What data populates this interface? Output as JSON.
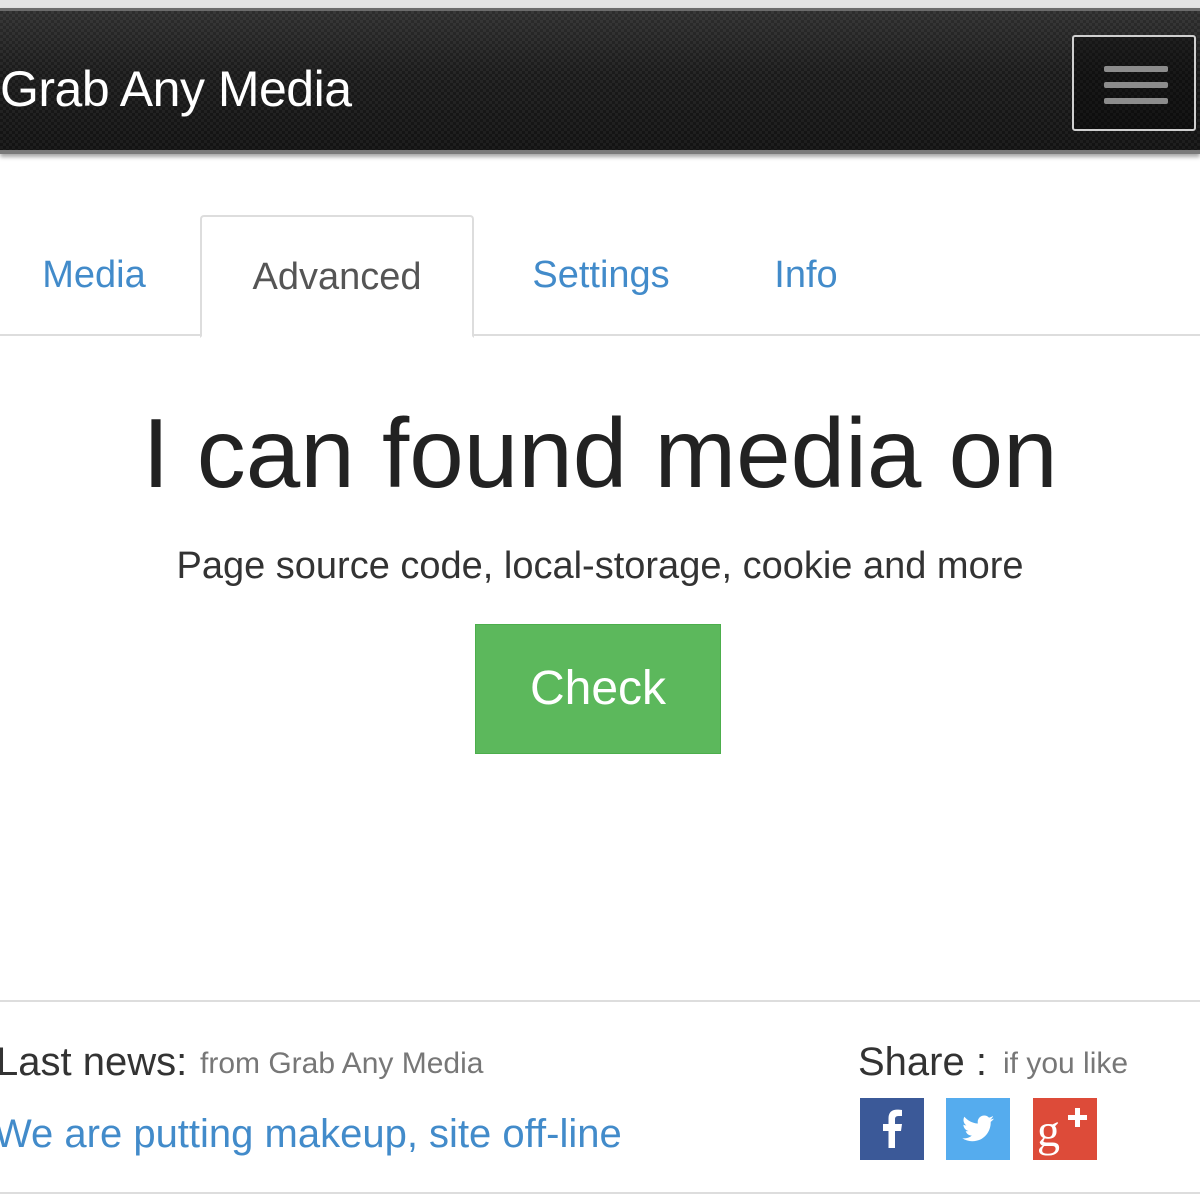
{
  "header": {
    "brand": "Grab Any Media",
    "menu_icon": "hamburger-menu-icon"
  },
  "tabs": [
    {
      "label": "Media",
      "active": false
    },
    {
      "label": "Advanced",
      "active": true
    },
    {
      "label": "Settings",
      "active": false
    },
    {
      "label": "Info",
      "active": false
    }
  ],
  "main": {
    "headline": "I can found media on",
    "subline": "Page source code, local-storage, cookie and more",
    "check_label": "Check"
  },
  "footer": {
    "news_label": "Last news:",
    "news_source": "from Grab Any Media",
    "news_link": "We are putting makeup, site off-line",
    "share_label": "Share :",
    "share_sub": "if you like",
    "share_icons": [
      "facebook-icon",
      "twitter-icon",
      "google-plus-icon"
    ]
  },
  "colors": {
    "link": "#428bca",
    "button_green": "#5cb85c",
    "facebook": "#3b5998",
    "twitter": "#55acee",
    "google_plus": "#dd4b39",
    "navbar": "#161616"
  }
}
